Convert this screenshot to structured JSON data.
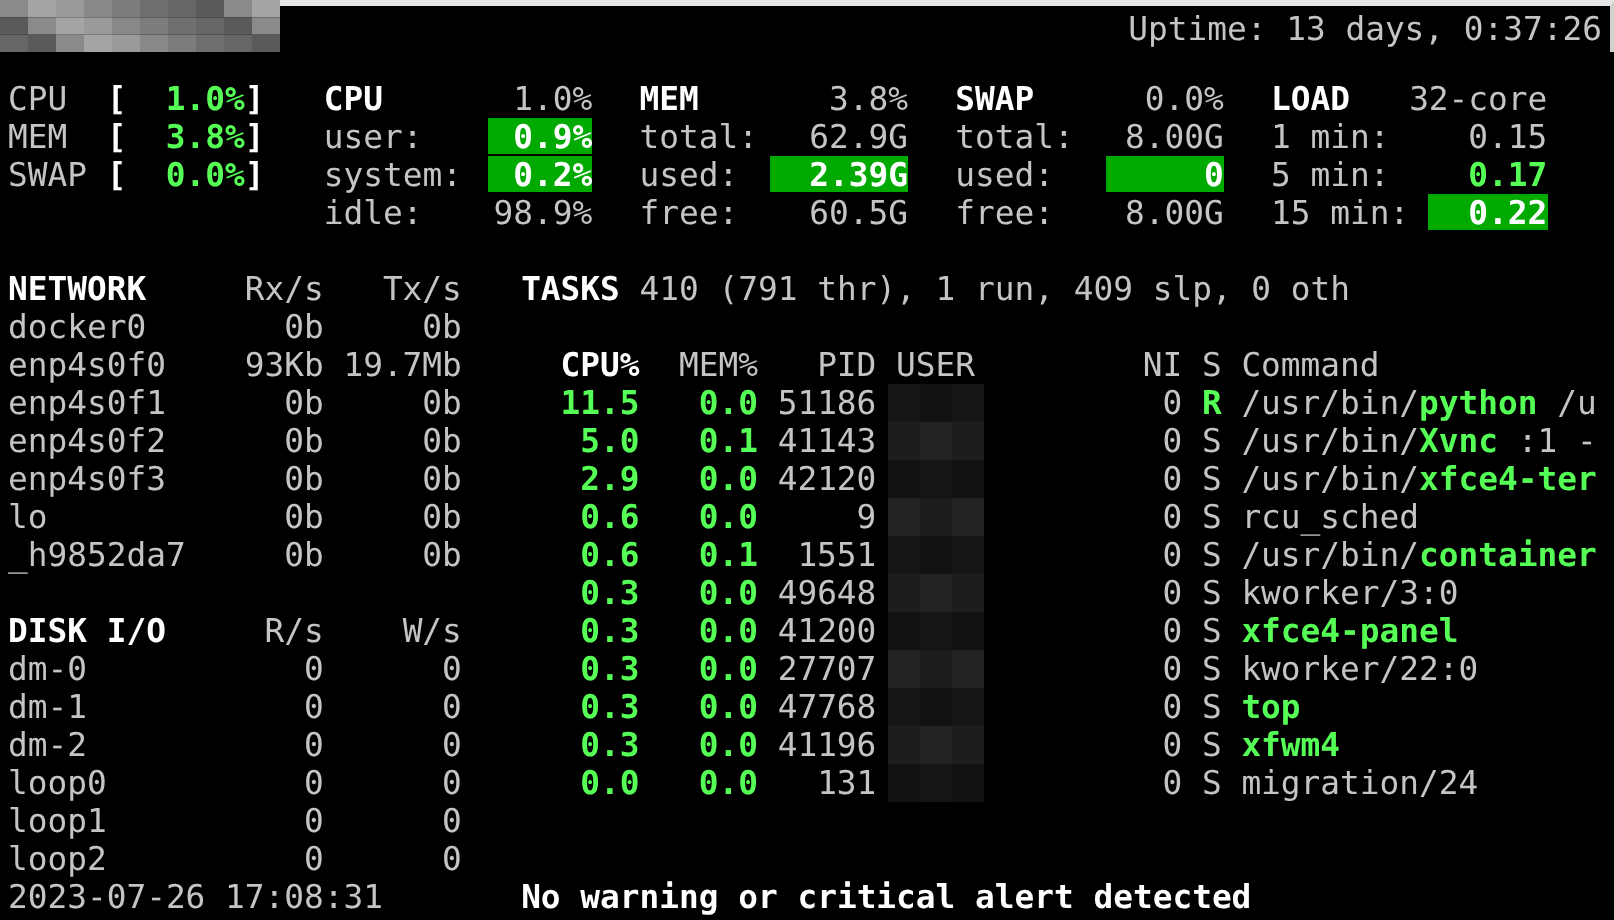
{
  "uptime": "Uptime: 13 days, 0:37:26",
  "quicklook": {
    "bar_start": "[",
    "bar_end": "]",
    "items": [
      {
        "label": "CPU",
        "value": "1.0%"
      },
      {
        "label": "MEM",
        "value": "3.8%"
      },
      {
        "label": "SWAP",
        "value": "0.0%"
      }
    ]
  },
  "cpu": {
    "title": "CPU",
    "total": "1.0%",
    "rows": [
      {
        "label": "user:",
        "value": "0.9%",
        "highlighted": true,
        "emphasized": false
      },
      {
        "label": "system:",
        "value": "0.2%",
        "highlighted": true,
        "emphasized": false
      },
      {
        "label": "idle:",
        "value": "98.9%",
        "highlighted": false,
        "emphasized": false
      }
    ]
  },
  "mem": {
    "title": "MEM",
    "total": "3.8%",
    "rows": [
      {
        "label": "total:",
        "value": "62.9G",
        "highlighted": false,
        "emphasized": false
      },
      {
        "label": "used:",
        "value": "2.39G",
        "highlighted": true,
        "emphasized": false
      },
      {
        "label": "free:",
        "value": "60.5G",
        "highlighted": false,
        "emphasized": false
      }
    ]
  },
  "swap": {
    "title": "SWAP",
    "total": "0.0%",
    "rows": [
      {
        "label": "total:",
        "value": "8.00G",
        "highlighted": false,
        "emphasized": false
      },
      {
        "label": "used:",
        "value": "0",
        "highlighted": true,
        "emphasized": false
      },
      {
        "label": "free:",
        "value": "8.00G",
        "highlighted": false,
        "emphasized": false
      }
    ]
  },
  "load": {
    "title": "LOAD",
    "total": "32-core",
    "rows": [
      {
        "label": "1 min:",
        "value": "0.15",
        "highlighted": false,
        "emphasized": false
      },
      {
        "label": "5 min:",
        "value": "0.17",
        "highlighted": false,
        "emphasized": true
      },
      {
        "label": "15 min:",
        "value": "0.22",
        "highlighted": true,
        "emphasized": false
      }
    ]
  },
  "network": {
    "title": "NETWORK",
    "columns": [
      "Rx/s",
      "Tx/s"
    ],
    "rows": [
      {
        "name": "docker0",
        "rx": "0b",
        "tx": "0b"
      },
      {
        "name": "enp4s0f0",
        "rx": "93Kb",
        "tx": "19.7Mb"
      },
      {
        "name": "enp4s0f1",
        "rx": "0b",
        "tx": "0b"
      },
      {
        "name": "enp4s0f2",
        "rx": "0b",
        "tx": "0b"
      },
      {
        "name": "enp4s0f3",
        "rx": "0b",
        "tx": "0b"
      },
      {
        "name": "lo",
        "rx": "0b",
        "tx": "0b"
      },
      {
        "name": "_h9852da7",
        "rx": "0b",
        "tx": "0b"
      }
    ]
  },
  "disk": {
    "title": "DISK I/O",
    "columns": [
      "R/s",
      "W/s"
    ],
    "rows": [
      {
        "name": "dm-0",
        "r": "0",
        "w": "0"
      },
      {
        "name": "dm-1",
        "r": "0",
        "w": "0"
      },
      {
        "name": "dm-2",
        "r": "0",
        "w": "0"
      },
      {
        "name": "loop0",
        "r": "0",
        "w": "0"
      },
      {
        "name": "loop1",
        "r": "0",
        "w": "0"
      },
      {
        "name": "loop2",
        "r": "0",
        "w": "0"
      }
    ]
  },
  "datetime": "2023-07-26 17:08:31",
  "tasks": {
    "title": "TASKS",
    "summary": "410 (791 thr), 1 run, 409 slp, 0 oth"
  },
  "process_columns": [
    {
      "label": "CPU%",
      "selected": true
    },
    {
      "label": "MEM%",
      "selected": false
    },
    {
      "label": "PID",
      "selected": false
    },
    {
      "label": "USER",
      "selected": false
    },
    {
      "label": "NI",
      "selected": false
    },
    {
      "label": "S",
      "selected": false
    },
    {
      "label": "Command",
      "selected": false
    }
  ],
  "processes": [
    {
      "cpu": "11.5",
      "mem": "0.0",
      "pid": "51186",
      "ni": "0",
      "s": "R",
      "running": true,
      "path": "/usr/bin/",
      "name": "python",
      "args": " /u",
      "highlighted": true
    },
    {
      "cpu": "5.0",
      "mem": "0.1",
      "pid": "41143",
      "ni": "0",
      "s": "S",
      "running": false,
      "path": "/usr/bin/",
      "name": "Xvnc",
      "args": " :1 -",
      "highlighted": true
    },
    {
      "cpu": "2.9",
      "mem": "0.0",
      "pid": "42120",
      "ni": "0",
      "s": "S",
      "running": false,
      "path": "/usr/bin/",
      "name": "xfce4-ter",
      "highlighted": true
    },
    {
      "cpu": "0.6",
      "mem": "0.0",
      "pid": "9",
      "ni": "0",
      "s": "S",
      "running": false,
      "name": "rcu_sched",
      "highlighted": false
    },
    {
      "cpu": "0.6",
      "mem": "0.1",
      "pid": "1551",
      "ni": "0",
      "s": "S",
      "running": false,
      "path": "/usr/bin/",
      "name": "container",
      "highlighted": true
    },
    {
      "cpu": "0.3",
      "mem": "0.0",
      "pid": "49648",
      "ni": "0",
      "s": "S",
      "running": false,
      "name": "kworker/3:0",
      "highlighted": false
    },
    {
      "cpu": "0.3",
      "mem": "0.0",
      "pid": "41200",
      "ni": "0",
      "s": "S",
      "running": false,
      "name": "xfce4-panel",
      "highlighted": true
    },
    {
      "cpu": "0.3",
      "mem": "0.0",
      "pid": "27707",
      "ni": "0",
      "s": "S",
      "running": false,
      "name": "kworker/22:0",
      "highlighted": false
    },
    {
      "cpu": "0.3",
      "mem": "0.0",
      "pid": "47768",
      "ni": "0",
      "s": "S",
      "running": false,
      "name": "top",
      "highlighted": true
    },
    {
      "cpu": "0.3",
      "mem": "0.0",
      "pid": "41196",
      "ni": "0",
      "s": "S",
      "running": false,
      "name": "xfwm4",
      "highlighted": true
    },
    {
      "cpu": "0.0",
      "mem": "0.0",
      "pid": "131",
      "ni": "0",
      "s": "S",
      "running": false,
      "name": "migration/24",
      "highlighted": false
    }
  ],
  "alert": "No warning or critical alert detected"
}
